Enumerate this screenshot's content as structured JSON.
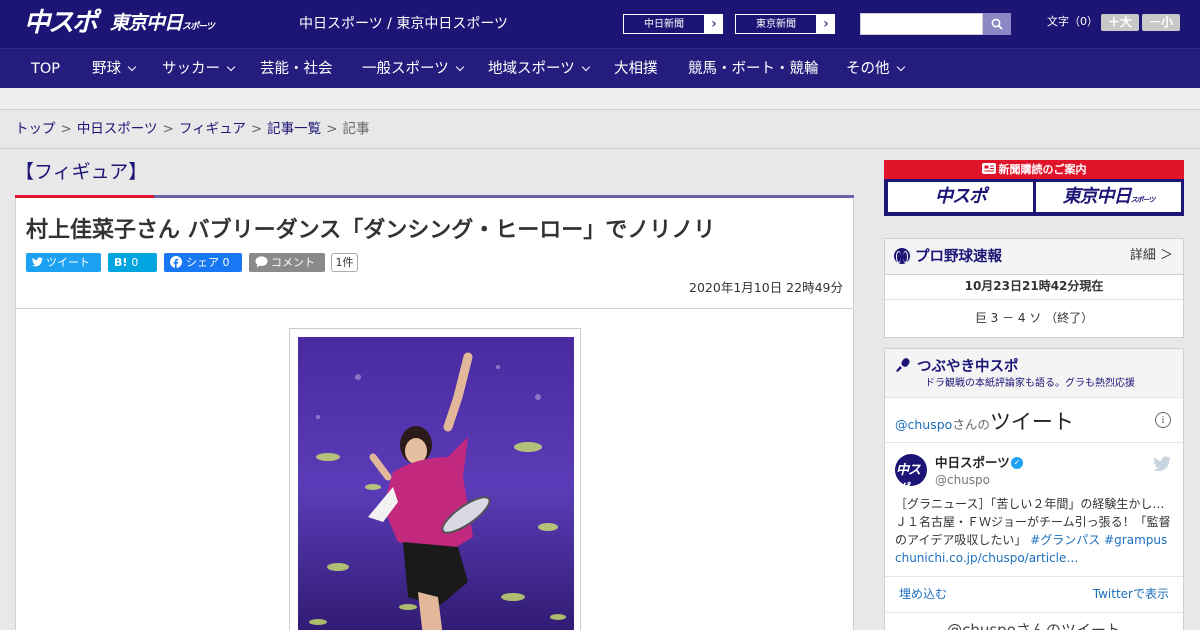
{
  "header": {
    "logo_primary": "中スポ",
    "logo_secondary": "東京中日",
    "logo_secondary_small": "スポーツ",
    "site_title": "中日スポーツ / 東京中日スポーツ",
    "paper_links": [
      {
        "label": "中日新聞",
        "arrow": "›"
      },
      {
        "label": "東京新聞",
        "arrow": "›"
      }
    ],
    "search_placeholder": "",
    "fontsize_label": "文字（0）",
    "fontsize_larger": "＋大",
    "fontsize_smaller": "－小"
  },
  "nav": {
    "items": [
      {
        "label": "TOP",
        "dropdown": false
      },
      {
        "label": "野球",
        "dropdown": true
      },
      {
        "label": "サッカー",
        "dropdown": true
      },
      {
        "label": "芸能・社会",
        "dropdown": false
      },
      {
        "label": "一般スポーツ",
        "dropdown": true
      },
      {
        "label": "地域スポーツ",
        "dropdown": true
      },
      {
        "label": "大相撲",
        "dropdown": false
      },
      {
        "label": "競馬・ボート・競輪",
        "dropdown": false
      },
      {
        "label": "その他",
        "dropdown": true
      }
    ]
  },
  "breadcrumb": {
    "items": [
      "トップ",
      "中日スポーツ",
      "フィギュア",
      "記事一覧",
      "記事"
    ],
    "separator": ">"
  },
  "article": {
    "category": "【フィギュア】",
    "headline": "村上佳菜子さん バブリーダンス「ダンシング・ヒーロー」でノリノリ",
    "share": {
      "tweet_label": "ツイート",
      "hatena_label": "B!",
      "hatena_count": "0",
      "facebook_label": "シェア",
      "facebook_count": "0",
      "comment_label": "コメント",
      "comment_count": "1件"
    },
    "published": "2020年1月10日 22時49分"
  },
  "sidebar": {
    "subscription": {
      "heading": "新聞購読のご案内",
      "logo_primary": "中スポ",
      "logo_secondary": "東京中日",
      "logo_secondary_small": "スポーツ"
    },
    "baseball": {
      "title": "プロ野球速報",
      "detail_link": "詳細 ＞",
      "updated": "10月23日21時42分現在",
      "result": "巨 3 － 4 ソ （終了）"
    },
    "tweets": {
      "title": "つぶやき中スポ",
      "subtitle": "ドラ観戦の本紙評論家も語る。グラも熱烈応援",
      "handle_prefix": "@chuspo",
      "handle_suffix": "さんの",
      "heading_word": "ツイート",
      "info_glyph": "i",
      "account_name": "中日スポーツ",
      "account_handle": "@chuspo",
      "avatar_text": "中スポ",
      "tweet_body": "［グラニュース］「苦しい２年間」の経験生かし… Ｊ１名古屋・ＦＷジョーがチーム引っ張る！「監督のアイデア吸収したい」",
      "hashtag_1": "#グランパス",
      "hashtag_2": "#grampus",
      "tweet_link": "chunichi.co.jp/chuspo/article…",
      "embed_label": "埋め込む",
      "view_label": "Twitterで表示",
      "more_label": "@chuspoさんのツイート"
    }
  },
  "colors": {
    "brand_navy": "#1c1576",
    "nav_bg": "#251d7e",
    "accent_red": "#e0142a",
    "twitter_blue": "#1da1f2",
    "facebook_blue": "#1877f2",
    "hatena_blue": "#00a4de"
  }
}
